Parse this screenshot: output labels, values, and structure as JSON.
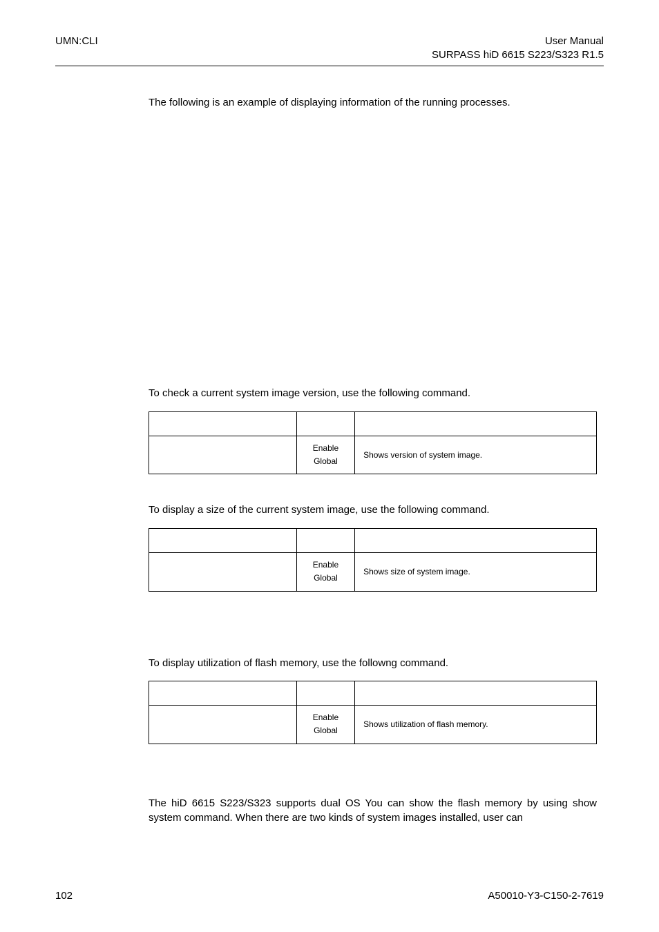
{
  "header": {
    "left": "UMN:CLI",
    "right_line1": "User  Manual",
    "right_line2": "SURPASS hiD 6615 S223/S323 R1.5"
  },
  "intro_text": "The following is an example of displaying information of the running processes.",
  "section_version": {
    "lead": "To check a current system image version, use the following command.",
    "mode_line1": "Enable",
    "mode_line2": "Global",
    "desc": "Shows version of system image."
  },
  "section_size": {
    "lead": "To display a size of the current system image, use the following command.",
    "mode_line1": "Enable",
    "mode_line2": "Global",
    "desc": "Shows size of system image."
  },
  "section_flash": {
    "lead": "To display utilization of flash memory, use the followng command.",
    "mode_line1": "Enable",
    "mode_line2": "Global",
    "desc": "Shows utilization of flash memory."
  },
  "section_dualos": {
    "text": "The hiD 6615 S223/S323 supports dual OS You can show the flash memory by using show system command. When there are two kinds of system images installed, user can"
  },
  "footer": {
    "page": "102",
    "doc": "A50010-Y3-C150-2-7619"
  }
}
